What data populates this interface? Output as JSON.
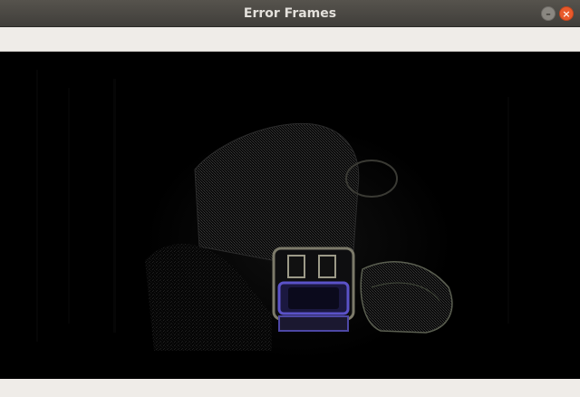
{
  "window": {
    "title": "Error Frames",
    "minimize_icon": "minimize-icon",
    "close_icon": "close-icon",
    "minimize_glyph": "–",
    "close_glyph": "×"
  },
  "colors": {
    "titlebar": "#48463f",
    "close_button": "#e95a2b",
    "frame_background": "#000000",
    "object_highlight": "#5b52c8"
  }
}
